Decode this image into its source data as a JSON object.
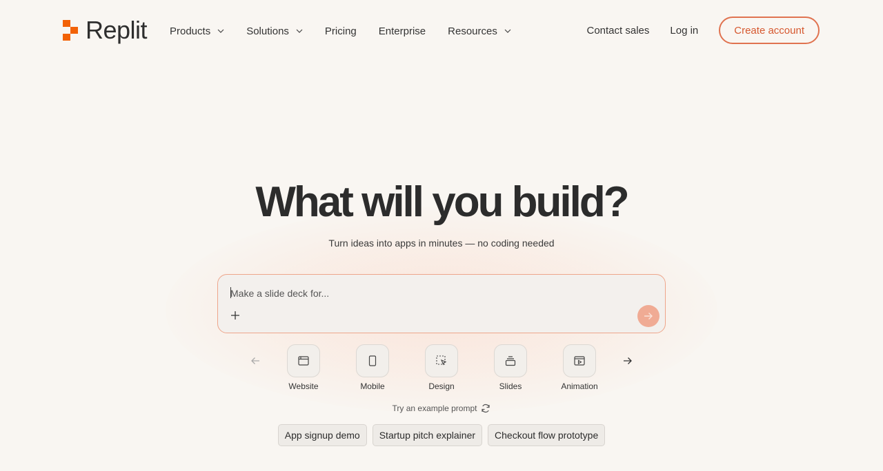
{
  "brand": {
    "name": "Replit",
    "accent": "#e0724f",
    "logo_color": "#f26207"
  },
  "nav": {
    "items": [
      {
        "label": "Products",
        "dropdown": true
      },
      {
        "label": "Solutions",
        "dropdown": true
      },
      {
        "label": "Pricing",
        "dropdown": false
      },
      {
        "label": "Enterprise",
        "dropdown": false
      },
      {
        "label": "Resources",
        "dropdown": true
      }
    ],
    "contact_sales": "Contact sales",
    "login": "Log in",
    "create_account": "Create account"
  },
  "hero": {
    "title": "What will you build?",
    "subtitle": "Turn ideas into apps in minutes — no coding needed"
  },
  "prompt": {
    "placeholder": "Make a slide deck for...",
    "attach_icon": "plus-icon",
    "submit_icon": "arrow-right-icon"
  },
  "categories": [
    {
      "label": "Website",
      "icon": "browser-window-icon"
    },
    {
      "label": "Mobile",
      "icon": "phone-icon"
    },
    {
      "label": "Design",
      "icon": "cursor-select-icon"
    },
    {
      "label": "Slides",
      "icon": "slides-stack-icon"
    },
    {
      "label": "Animation",
      "icon": "play-window-icon"
    }
  ],
  "examples": {
    "label": "Try an example prompt",
    "chips": [
      "App signup demo",
      "Startup pitch explainer",
      "Checkout flow prototype"
    ]
  }
}
